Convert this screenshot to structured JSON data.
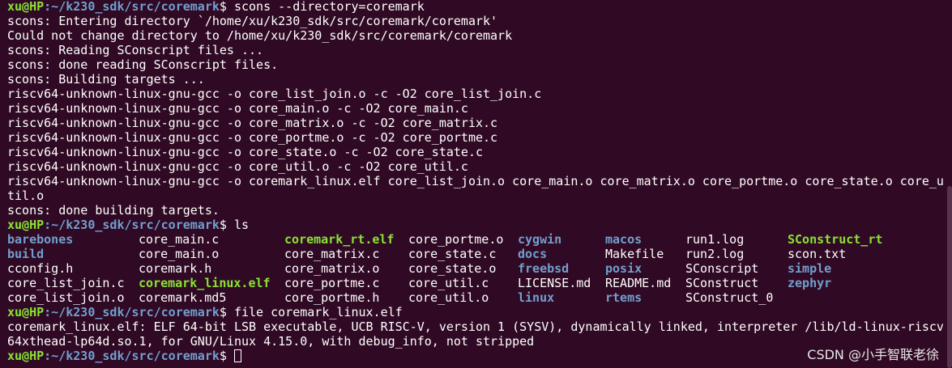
{
  "terminal": {
    "background": "#300a24",
    "colors": {
      "prompt_user": "#8ae234",
      "prompt_path": "#729fcf",
      "directory": "#729fcf",
      "executable": "#8ae234"
    },
    "prompt_1": {
      "user_host": "xu@HP",
      "path": ":~/k230_sdk/src/coremark",
      "symbol": "$",
      "command": " scons --directory=coremark"
    },
    "output_1": [
      "scons: Entering directory `/home/xu/k230_sdk/src/coremark/coremark'",
      "Could not change directory to /home/xu/k230_sdk/src/coremark/coremark",
      "scons: Reading SConscript files ...",
      "scons: done reading SConscript files.",
      "scons: Building targets ...",
      "riscv64-unknown-linux-gnu-gcc -o core_list_join.o -c -O2 core_list_join.c",
      "riscv64-unknown-linux-gnu-gcc -o core_main.o -c -O2 core_main.c",
      "riscv64-unknown-linux-gnu-gcc -o core_matrix.o -c -O2 core_matrix.c",
      "riscv64-unknown-linux-gnu-gcc -o core_portme.o -c -O2 core_portme.c",
      "riscv64-unknown-linux-gnu-gcc -o core_state.o -c -O2 core_state.c",
      "riscv64-unknown-linux-gnu-gcc -o core_util.o -c -O2 core_util.c",
      "riscv64-unknown-linux-gnu-gcc -o coremark_linux.elf core_list_join.o core_main.o core_matrix.o core_portme.o core_state.o core_u",
      "til.o",
      "scons: done building targets."
    ],
    "prompt_2": {
      "user_host": "xu@HP",
      "path": ":~/k230_sdk/src/coremark",
      "symbol": "$",
      "command": " ls"
    },
    "ls_rows": [
      [
        {
          "name": "barebones",
          "kind": "dir"
        },
        {
          "name": "core_main.c",
          "kind": "file"
        },
        {
          "name": "coremark_rt.elf",
          "kind": "exe"
        },
        {
          "name": "core_portme.o",
          "kind": "file"
        },
        {
          "name": "cygwin",
          "kind": "dir"
        },
        {
          "name": "macos",
          "kind": "dir"
        },
        {
          "name": "run1.log",
          "kind": "file"
        },
        {
          "name": "SConstruct_rt",
          "kind": "exe"
        }
      ],
      [
        {
          "name": "build",
          "kind": "dir"
        },
        {
          "name": "core_main.o",
          "kind": "file"
        },
        {
          "name": "core_matrix.c",
          "kind": "file"
        },
        {
          "name": "core_state.c",
          "kind": "file"
        },
        {
          "name": "docs",
          "kind": "dir"
        },
        {
          "name": "Makefile",
          "kind": "file"
        },
        {
          "name": "run2.log",
          "kind": "file"
        },
        {
          "name": "scon.txt",
          "kind": "file"
        }
      ],
      [
        {
          "name": "cconfig.h",
          "kind": "file"
        },
        {
          "name": "coremark.h",
          "kind": "file"
        },
        {
          "name": "core_matrix.o",
          "kind": "file"
        },
        {
          "name": "core_state.o",
          "kind": "file"
        },
        {
          "name": "freebsd",
          "kind": "dir"
        },
        {
          "name": "posix",
          "kind": "dir"
        },
        {
          "name": "SConscript",
          "kind": "file"
        },
        {
          "name": "simple",
          "kind": "dir"
        }
      ],
      [
        {
          "name": "core_list_join.c",
          "kind": "file"
        },
        {
          "name": "coremark_linux.elf",
          "kind": "exe"
        },
        {
          "name": "core_portme.c",
          "kind": "file"
        },
        {
          "name": "core_util.c",
          "kind": "file"
        },
        {
          "name": "LICENSE.md",
          "kind": "file"
        },
        {
          "name": "README.md",
          "kind": "file"
        },
        {
          "name": "SConstruct",
          "kind": "file"
        },
        {
          "name": "zephyr",
          "kind": "dir"
        }
      ],
      [
        {
          "name": "core_list_join.o",
          "kind": "file"
        },
        {
          "name": "coremark.md5",
          "kind": "file"
        },
        {
          "name": "core_portme.h",
          "kind": "file"
        },
        {
          "name": "core_util.o",
          "kind": "file"
        },
        {
          "name": "linux",
          "kind": "dir"
        },
        {
          "name": "rtems",
          "kind": "dir"
        },
        {
          "name": "SConstruct_0",
          "kind": "file"
        }
      ]
    ],
    "prompt_3": {
      "user_host": "xu@HP",
      "path": ":~/k230_sdk/src/coremark",
      "symbol": "$",
      "command": " file coremark_linux.elf"
    },
    "output_3": [
      "coremark_linux.elf: ELF 64-bit LSB executable, UCB RISC-V, version 1 (SYSV), dynamically linked, interpreter /lib/ld-linux-riscv",
      "64xthead-lp64d.so.1, for GNU/Linux 4.15.0, with debug_info, not stripped"
    ],
    "prompt_4": {
      "user_host": "xu@HP",
      "path": ":~/k230_sdk/src/coremark",
      "symbol": "$",
      "command": " "
    }
  },
  "watermark": "CSDN @小手智联老徐"
}
